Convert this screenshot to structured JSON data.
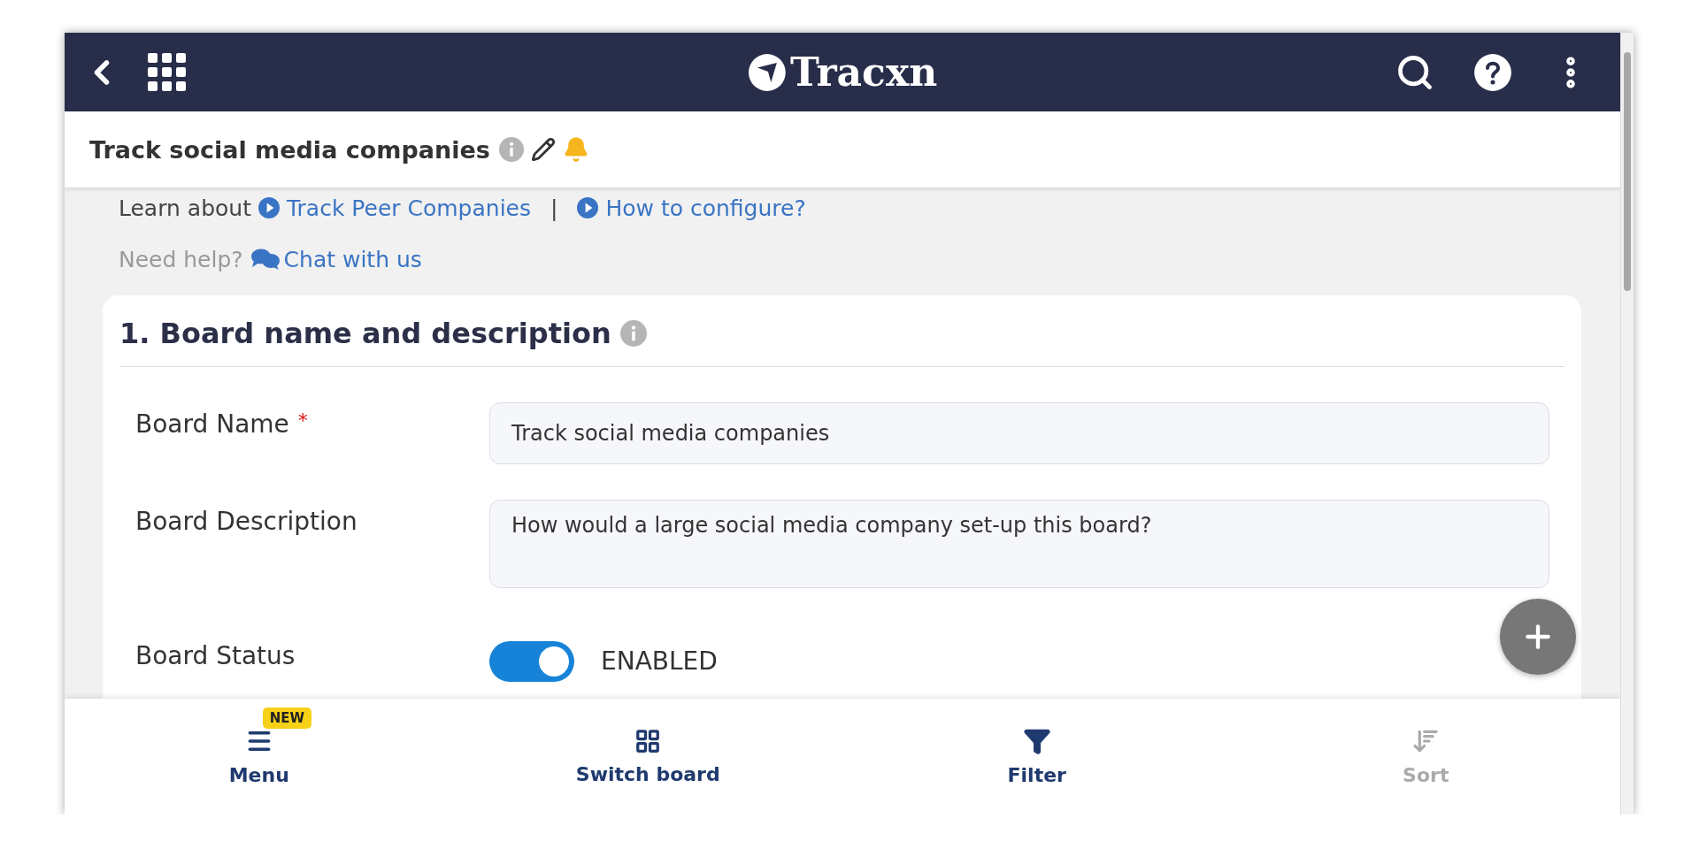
{
  "header": {
    "logo": "Tracxn"
  },
  "board_title": "Track social media companies",
  "learn": {
    "label": "Learn about",
    "links": [
      "Track Peer Companies",
      "How to configure?"
    ],
    "separator": "|"
  },
  "help": {
    "label": "Need help?",
    "link": "Chat with us"
  },
  "section": {
    "title": "1. Board name and description",
    "fields": [
      {
        "kind": "input",
        "label": "Board Name",
        "required_mark": "*",
        "value": "Track social media companies"
      },
      {
        "kind": "textarea",
        "label": "Board Description",
        "value": "How would a large social media company set-up this board?"
      },
      {
        "kind": "toggle",
        "label": "Board Status",
        "on": true,
        "status": "ENABLED"
      }
    ]
  },
  "bottom_nav": [
    {
      "kind": "menu",
      "label": "Menu",
      "badge": "NEW",
      "disabled": false
    },
    {
      "kind": "switch",
      "label": "Switch board",
      "disabled": false
    },
    {
      "kind": "filter",
      "label": "Filter",
      "disabled": false
    },
    {
      "kind": "sort",
      "label": "Sort",
      "disabled": true
    }
  ]
}
